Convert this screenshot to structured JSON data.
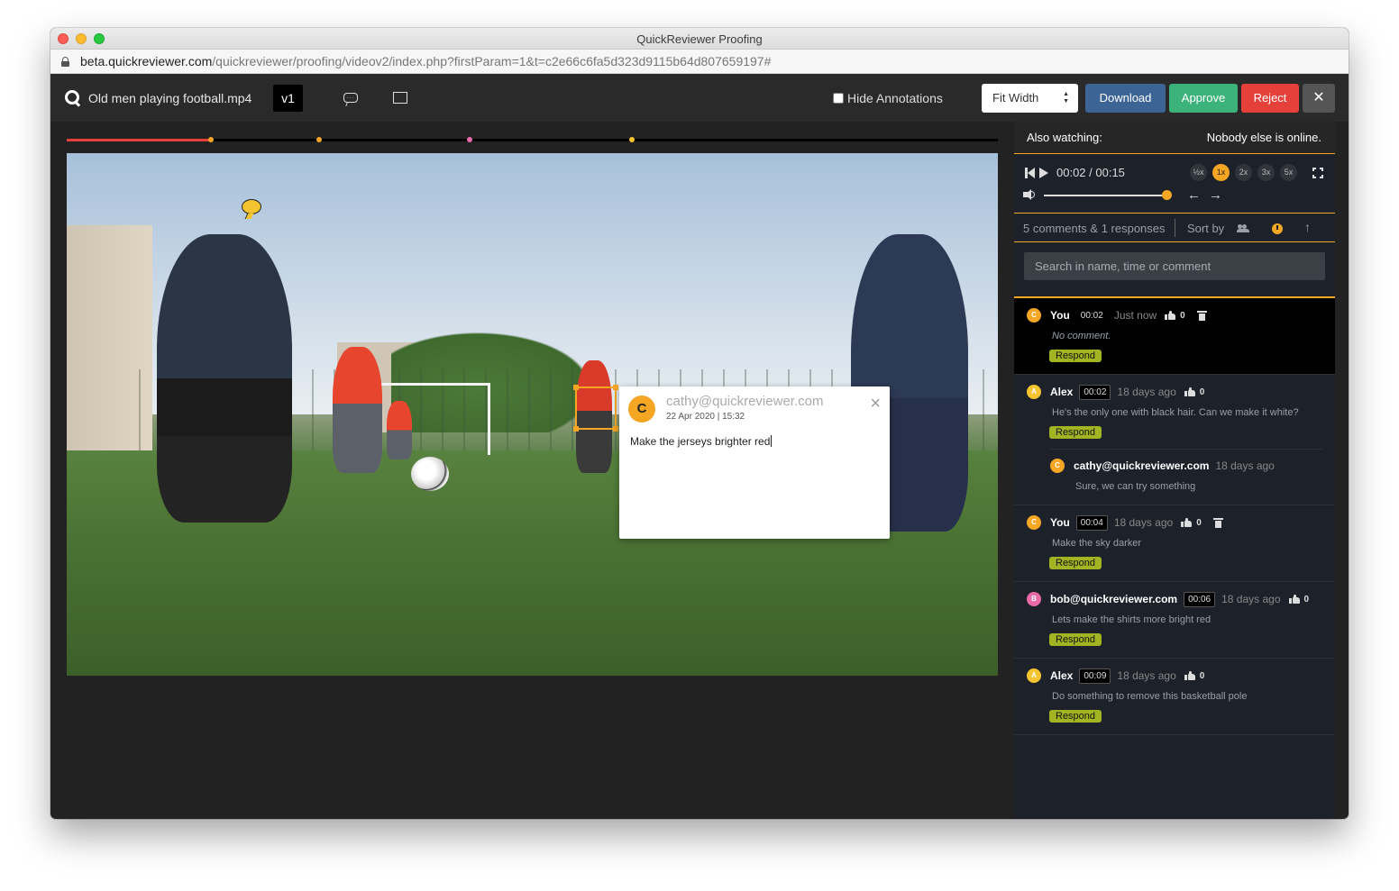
{
  "window": {
    "title": "QuickReviewer Proofing"
  },
  "address_bar": {
    "host": "beta.quickreviewer.com",
    "path": "/quickreviewer/proofing/videov2/index.php?firstParam=1&t=c2e66c6fa5d323d9115b64d807659197#"
  },
  "toolbar": {
    "file_name": "Old men playing football.mp4",
    "version": "v1",
    "hide_annotations_label": "Hide Annotations",
    "fit_select_value": "Fit Width",
    "download_label": "Download",
    "approve_label": "Approve",
    "reject_label": "Reject",
    "close_label": "✕"
  },
  "timeline": {
    "progress": 0.155,
    "markers": [
      {
        "time": "00:02",
        "position": 0.155,
        "color": "#f5a623"
      },
      {
        "time": "00:04",
        "position": 0.271,
        "color": "#f5a623"
      },
      {
        "time": "00:06",
        "position": 0.433,
        "color": "#e86aa6"
      },
      {
        "time": "00:09",
        "position": 0.607,
        "color": "#f5c431"
      }
    ]
  },
  "annotation_popup": {
    "avatar_letter": "C",
    "email": "cathy@quickreviewer.com",
    "date": "22 Apr 2020 | 15:32",
    "text": "Make the jerseys brighter red",
    "close_label": "×"
  },
  "sidebar": {
    "also_watching_label": "Also watching:",
    "online_status": "Nobody else is online.",
    "player": {
      "time": "00:02 / 00:15",
      "speeds": [
        "½x",
        "1x",
        "2x",
        "3x",
        "5x"
      ],
      "active_speed": "1x",
      "volume": 1.0
    },
    "comment_count": "5 comments & 1 responses",
    "sort_by_label": "Sort by",
    "search_placeholder": "Search in name, time or comment",
    "respond_label": "Respond",
    "comments": [
      {
        "avatar": "C",
        "avatar_color": "#f5a623",
        "name": "You",
        "time": "00:02",
        "ago": "Just now",
        "likes": "0",
        "text": "No comment.",
        "italic": true,
        "deletable": true,
        "active": true
      },
      {
        "avatar": "A",
        "avatar_color": "#f5c431",
        "name": "Alex",
        "time": "00:02",
        "ago": "18 days ago",
        "likes": "0",
        "text": "He's the only one with black hair. Can we make it white?",
        "response": {
          "avatar": "C",
          "avatar_color": "#f5a623",
          "name": "cathy@quickreviewer.com",
          "ago": "18 days ago",
          "text": "Sure, we can try something"
        }
      },
      {
        "avatar": "C",
        "avatar_color": "#f5a623",
        "name": "You",
        "time": "00:04",
        "ago": "18 days ago",
        "likes": "0",
        "text": "Make the sky darker",
        "deletable": true
      },
      {
        "avatar": "B",
        "avatar_color": "#e86aa6",
        "name": "bob@quickreviewer.com",
        "time": "00:06",
        "ago": "18 days ago",
        "likes": "0",
        "text": "Lets make the shirts more bright red"
      },
      {
        "avatar": "A",
        "avatar_color": "#f5c431",
        "name": "Alex",
        "time": "00:09",
        "ago": "18 days ago",
        "likes": "0",
        "text": "Do something to remove this basketball pole"
      }
    ]
  }
}
